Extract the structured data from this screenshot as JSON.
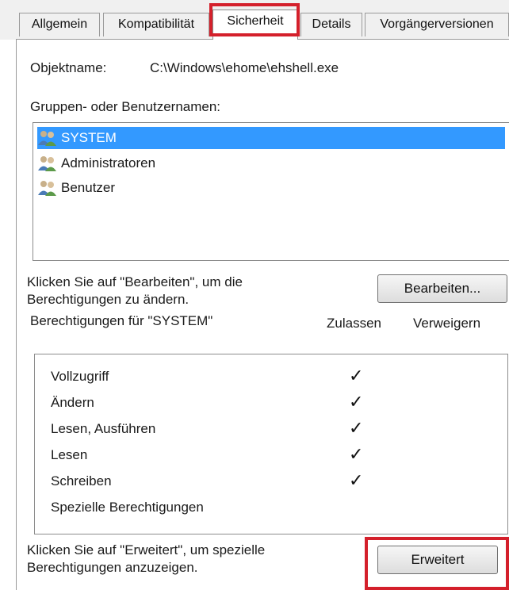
{
  "tabs": [
    {
      "label": "Allgemein"
    },
    {
      "label": "Kompatibilität"
    },
    {
      "label": "Sicherheit"
    },
    {
      "label": "Details"
    },
    {
      "label": "Vorgängerversionen"
    }
  ],
  "object": {
    "label": "Objektname:",
    "value": "C:\\Windows\\ehome\\ehshell.exe"
  },
  "groups": {
    "label": "Gruppen- oder Benutzernamen:",
    "items": [
      "SYSTEM",
      "Administratoren",
      "Benutzer"
    ]
  },
  "edit": {
    "hint_line1": "Klicken Sie auf \"Bearbeiten\", um die",
    "hint_line2": "Berechtigungen zu ändern.",
    "button": "Bearbeiten..."
  },
  "permissions": {
    "title": "Berechtigungen für \"SYSTEM\"",
    "col_allow": "Zulassen",
    "col_deny": "Verweigern",
    "rows": [
      {
        "name": "Vollzugriff",
        "allow": "✓"
      },
      {
        "name": "Ändern",
        "allow": "✓"
      },
      {
        "name": "Lesen, Ausführen",
        "allow": "✓"
      },
      {
        "name": "Lesen",
        "allow": "✓"
      },
      {
        "name": "Schreiben",
        "allow": "✓"
      },
      {
        "name": "Spezielle Berechtigungen",
        "allow": ""
      }
    ]
  },
  "advanced": {
    "hint_line1": "Klicken Sie auf \"Erweitert\", um spezielle",
    "hint_line2": "Berechtigungen anzuzeigen.",
    "button": "Erweitert"
  },
  "colors": {
    "highlight": "#d4202b",
    "selection": "#3399ff"
  }
}
